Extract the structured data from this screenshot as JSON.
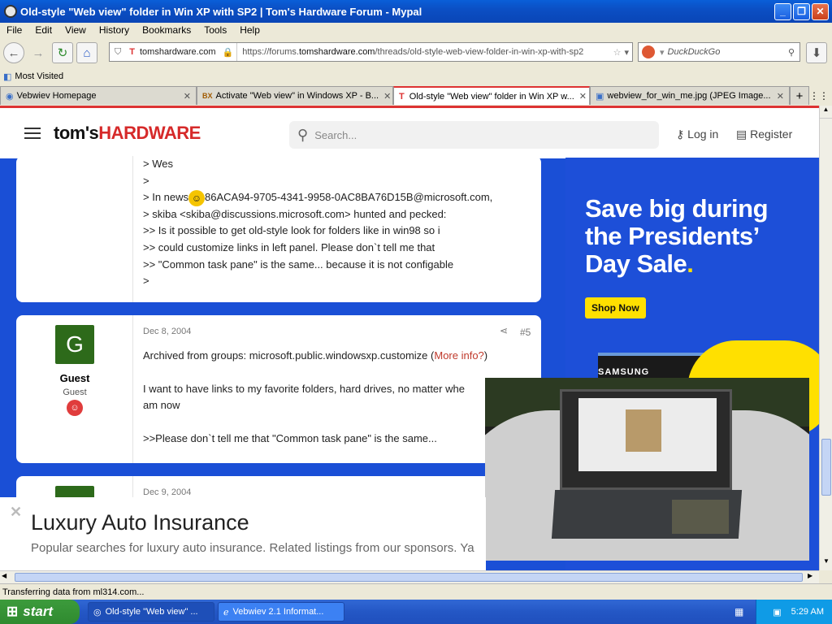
{
  "window": {
    "title": "Old-style \"Web view\" folder in Win XP with SP2 | Tom's Hardware Forum - Mypal"
  },
  "menu": [
    "File",
    "Edit",
    "View",
    "History",
    "Bookmarks",
    "Tools",
    "Help"
  ],
  "nav": {
    "site": "tomshardware.com",
    "url_prefix": "https://forums.",
    "url_domain": "tomshardware.com",
    "url_path": "/threads/old-style-web-view-folder-in-win-xp-with-sp2",
    "search_placeholder": "DuckDuckGo"
  },
  "bookmarks": {
    "most_visited": "Most Visited"
  },
  "tabs": [
    {
      "label": "Vebwiev Homepage"
    },
    {
      "label": "Activate \"Web view\" in Windows XP - B..."
    },
    {
      "label": "Old-style \"Web view\" folder in Win XP w..."
    },
    {
      "label": "webview_for_win_me.jpg (JPEG Image..."
    }
  ],
  "site": {
    "logo_prefix": "tom's",
    "logo_suffix": "HARDWARE",
    "search_placeholder": "Search...",
    "login": "Log in",
    "register": "Register"
  },
  "post1": {
    "lines": [
      "> Wes",
      ">",
      "86ACA94-9705-4341-9958-0AC8BA76D15B@microsoft.com,",
      "> skiba <skiba@discussions.microsoft.com> hunted and pecked:",
      ">> Is it possible to get old-style look for folders like in win98 so i",
      ">> could customize links in left panel. Please don`t tell me that",
      ">> \"Common task pane\" is the same... because it is not configable",
      ">"
    ],
    "news_prefix": "> In news"
  },
  "post2": {
    "avatar_letter": "G",
    "user": "Guest",
    "role": "Guest",
    "date": "Dec 8, 2004",
    "number": "#5",
    "archived": "Archived from groups: microsoft.public.windowsxp.customize (",
    "more_info": "More info?",
    "archived_close": ")",
    "line1": "I want to have links to my favorite folders, hard drives, no matter whe",
    "line2": "am now",
    "line3": ">>Please don`t tell me that \"Common task pane\" is the same..."
  },
  "post3": {
    "date": "Dec 9, 2004"
  },
  "ad": {
    "headline1": "Save big during",
    "headline2": "the Presidents’",
    "headline3": "Day Sale",
    "cta": "Shop Now",
    "brand": "SAMSUNG"
  },
  "banner": {
    "title": "Luxury Auto Insurance",
    "text": "Popular searches for luxury auto insurance. Related listings from our sponsors. Ya"
  },
  "status": "Transferring data from ml314.com...",
  "taskbar": {
    "start": "start",
    "items": [
      "Old-style \"Web view\" ...",
      "Vebwiev 2.1 Informat..."
    ],
    "clock": "5:29 AM"
  }
}
